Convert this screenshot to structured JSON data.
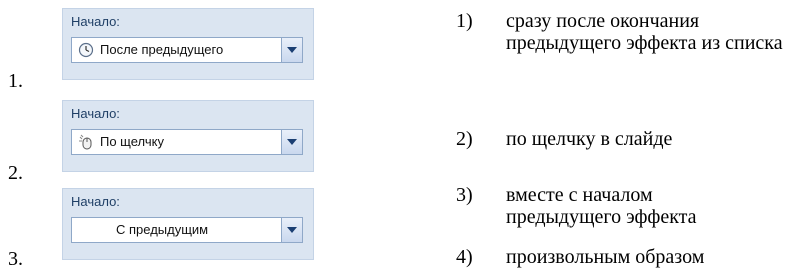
{
  "left_numbers": [
    "1.",
    "2.",
    "3."
  ],
  "panels": [
    {
      "label": "Начало:",
      "value": "После предыдущего",
      "icon": "clock-icon"
    },
    {
      "label": "Начало:",
      "value": "По щелчку",
      "icon": "mouse-click-icon"
    },
    {
      "label": "Начало:",
      "value": "С предыдущим",
      "icon": ""
    }
  ],
  "options": [
    {
      "num": "1)",
      "text": "сразу после окончания предыдущего эффекта из списка"
    },
    {
      "num": "2)",
      "text": "по щелчку в слайде"
    },
    {
      "num": "3)",
      "text": "вместе с началом предыдущего эффекта"
    },
    {
      "num": "4)",
      "text": "произвольным образом"
    }
  ],
  "colors": {
    "panel_bg": "#dbe5f1",
    "label": "#1f3f66",
    "arrow": "#1b3f73"
  }
}
